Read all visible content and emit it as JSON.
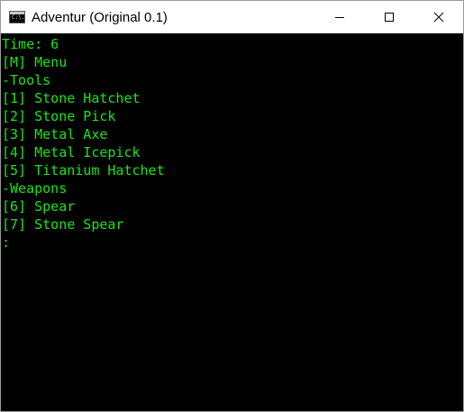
{
  "window": {
    "title": "Adventur (Original 0.1)",
    "icon_label": "C:\\."
  },
  "controls": {
    "minimize": "minimize-icon",
    "maximize": "maximize-icon",
    "close": "close-icon"
  },
  "console": {
    "text_color": "#19e619",
    "background": "#000000",
    "lines": [
      "Time: 6",
      "[M] Menu",
      "-Tools",
      "[1] Stone Hatchet",
      "[2] Stone Pick",
      "[3] Metal Axe",
      "[4] Metal Icepick",
      "[5] Titanium Hatchet",
      "-Weapons",
      "[6] Spear",
      "[7] Stone Spear",
      ":"
    ]
  }
}
